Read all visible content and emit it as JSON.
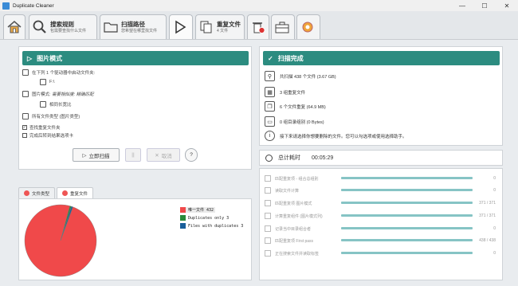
{
  "window": {
    "title": "Duplicate Cleaner",
    "minimize": "—",
    "maximize": "☐",
    "close": "✕"
  },
  "toolbar": {
    "search_rules_title": "搜索规则",
    "search_rules_sub": "包需要查找什么文件",
    "scan_path_title": "扫描路径",
    "scan_path_sub": "您希望在哪里找文件",
    "dup_files_title": "重复文件",
    "dup_files_sub": "4 文件"
  },
  "image_mode": {
    "header": "图片模式",
    "scan_in_label": "在下列 1 个驱动器中启动文件夹:",
    "drive": "F:\\",
    "mode_label": "图片模式:",
    "mode_value": "需要相似度: 精确匹配",
    "similar_label": "相同长宽比",
    "types_label": "所有文件类型 (图片类型)",
    "dup_folder_label": "查找重复文件夹",
    "after_scan_label": "完成后转到结果选项卡",
    "scan_button": "立即扫描",
    "pause_button": "||",
    "cancel_button": "取消",
    "help_button": "?"
  },
  "scan_complete": {
    "header": "扫描完成",
    "total_files": "共扫描 438 个文件 (3.67 GB)",
    "dup_groups": "3 组重复文件",
    "dup_files": "6 个文件重复 (64.9 MB)",
    "zero_groups": "0 组目录组别 (0 Bytes)",
    "tip": "接下来请选择你想要删除的文件。您可以勾选项或使用选择助手。"
  },
  "timer": {
    "label": "总计耗时",
    "value": "00:05:29"
  },
  "progress": [
    {
      "label": "匹配重复项 - 组合总组别",
      "value": "0",
      "bar": 1.0
    },
    {
      "label": "读取文件计算",
      "value": "0",
      "bar": 1.0
    },
    {
      "label": "匹配重复项 图片模式",
      "value": "371 / 371",
      "bar": 1.0
    },
    {
      "label": "计算重复组件 (图片模式列)",
      "value": "371 / 371",
      "bar": 1.0
    },
    {
      "label": "记录当中目录组合者",
      "value": "0",
      "bar": 1.0
    },
    {
      "label": "匹配重复项 First pass",
      "value": "438 / 438",
      "bar": 1.0
    },
    {
      "label": "正在搜索文件并读取标签",
      "value": "0",
      "bar": 1.0
    }
  ],
  "chart_tabs": {
    "file_types": "文件类型",
    "dup_files": "重复文件"
  },
  "chart_data": {
    "type": "pie",
    "categories": [
      "唯一文件 432",
      "Duplicates only 3",
      "Files with duplicates 3"
    ],
    "values": [
      432,
      3,
      3
    ],
    "colors": [
      "#f0494a",
      "#2a8a3a",
      "#1a5f9a"
    ]
  }
}
